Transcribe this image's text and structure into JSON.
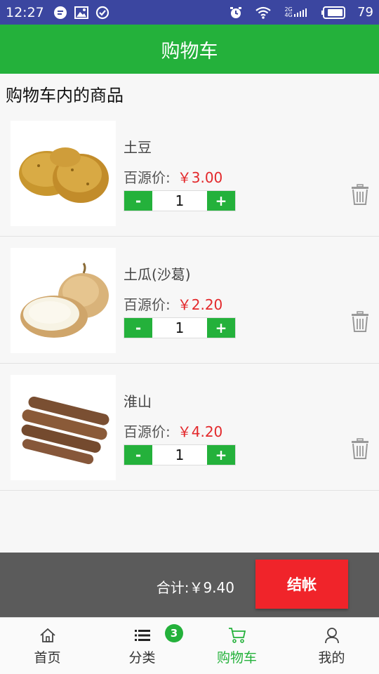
{
  "status_bar": {
    "time": "12:27",
    "battery_percent": "79",
    "network_labels": [
      "2G",
      "4G"
    ],
    "icons": [
      "message-icon",
      "image-icon",
      "check-circle-icon",
      "alarm-icon",
      "wifi-icon",
      "signal-icon",
      "battery-icon"
    ]
  },
  "header": {
    "title": "购物车"
  },
  "cart": {
    "section_title": "购物车内的商品",
    "price_label": "百源价:",
    "decrement_label": "-",
    "increment_label": "+",
    "items": [
      {
        "name": "土豆",
        "price": "￥3.00",
        "quantity": "1",
        "image": "potato-image"
      },
      {
        "name": "土瓜(沙葛)",
        "price": "￥2.20",
        "quantity": "1",
        "image": "jicama-image"
      },
      {
        "name": "淮山",
        "price": "￥4.20",
        "quantity": "1",
        "image": "yam-image"
      }
    ]
  },
  "checkout": {
    "total_text": "合计:￥9.40",
    "button_label": "结帐"
  },
  "bottom_nav": {
    "items": [
      {
        "label": "首页",
        "icon": "home-icon",
        "active": false
      },
      {
        "label": "分类",
        "icon": "list-icon",
        "active": false
      },
      {
        "label": "购物车",
        "icon": "cart-icon",
        "active": true,
        "badge": "3"
      },
      {
        "label": "我的",
        "icon": "user-icon",
        "active": false
      }
    ]
  },
  "colors": {
    "accent": "#24b13b",
    "price": "#e3282b",
    "checkout_button": "#f0242a",
    "status_bar": "#3b46a0"
  }
}
